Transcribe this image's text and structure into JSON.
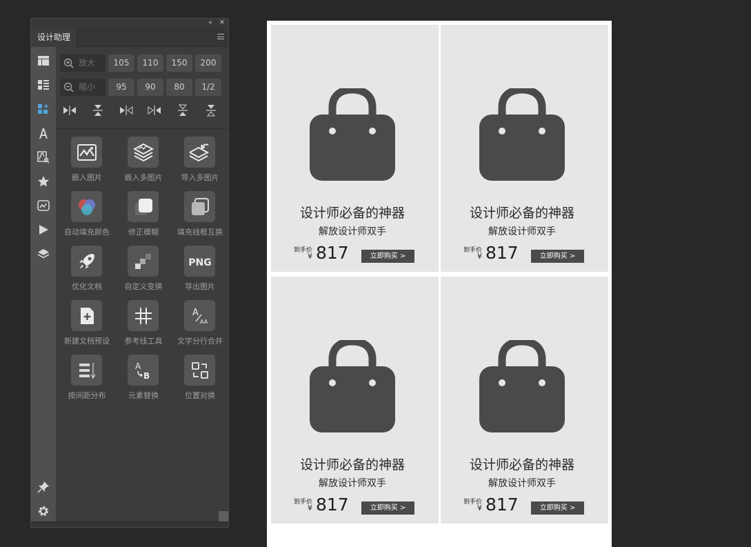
{
  "panel": {
    "tab_label": "设计助理",
    "zoom_in": {
      "label": "放大",
      "levels": [
        "105",
        "110",
        "150",
        "200"
      ]
    },
    "zoom_out": {
      "label": "缩小",
      "levels": [
        "95",
        "90",
        "80",
        "1/2"
      ]
    },
    "sidebar_icons": [
      "layout-icon",
      "list-layout-icon",
      "widgets-icon",
      "text-icon",
      "text-search-icon",
      "star-icon",
      "image-icon",
      "play-icon",
      "layers-icon",
      "pin-icon",
      "gear-icon"
    ],
    "align_icons": [
      "align-horizontal-center-icon",
      "align-vertical-center-icon",
      "align-right-icon",
      "align-left-icon",
      "distribute-vertical-icon",
      "distribute-vertical-alt-icon"
    ],
    "tools": [
      {
        "label": "嵌入图片",
        "icon": "embed-image-icon"
      },
      {
        "label": "嵌入多图片",
        "icon": "embed-multi-image-icon"
      },
      {
        "label": "导入多图片",
        "icon": "import-multi-image-icon"
      },
      {
        "label": "自动填充颜色",
        "icon": "auto-fill-color-icon"
      },
      {
        "label": "修正模糊",
        "icon": "fix-blur-icon"
      },
      {
        "label": "填充线框互换",
        "icon": "fill-stroke-swap-icon"
      },
      {
        "label": "优化文档",
        "icon": "rocket-icon"
      },
      {
        "label": "自定义变换",
        "icon": "custom-transform-icon"
      },
      {
        "label": "导出图片",
        "icon": "png-export-icon"
      },
      {
        "label": "新建文档预设",
        "icon": "new-document-icon"
      },
      {
        "label": "参考线工具",
        "icon": "guide-grid-icon"
      },
      {
        "label": "文字分行合并",
        "icon": "text-split-merge-icon"
      },
      {
        "label": "按间距分布",
        "icon": "distribute-spacing-icon"
      },
      {
        "label": "元素替换",
        "icon": "element-replace-icon"
      },
      {
        "label": "位置对换",
        "icon": "position-swap-icon"
      }
    ]
  },
  "products": [
    {
      "title": "设计师必备的神器",
      "subtitle": "解放设计师双手",
      "price_label": "到手价",
      "currency": "¥",
      "price": "817",
      "button": "立即购买 >"
    },
    {
      "title": "设计师必备的神器",
      "subtitle": "解放设计师双手",
      "price_label": "到手价",
      "currency": "¥",
      "price": "817",
      "button": "立即购买 >"
    },
    {
      "title": "设计师必备的神器",
      "subtitle": "解放设计师双手",
      "price_label": "到手价",
      "currency": "¥",
      "price": "817",
      "button": "立即购买 >"
    },
    {
      "title": "设计师必备的神器",
      "subtitle": "解放设计师双手",
      "price_label": "到手价",
      "currency": "¥",
      "price": "817",
      "button": "立即购买 >"
    }
  ],
  "colors": {
    "app_background": "#282828",
    "panel_background": "#3c3c3c",
    "sidebar_background": "#505050",
    "active_sidebar_icon": "#4fa6e0",
    "card_background": "#e6e6e6",
    "bag_color": "#4a4a4a",
    "buy_button": "#4a4a4a"
  }
}
